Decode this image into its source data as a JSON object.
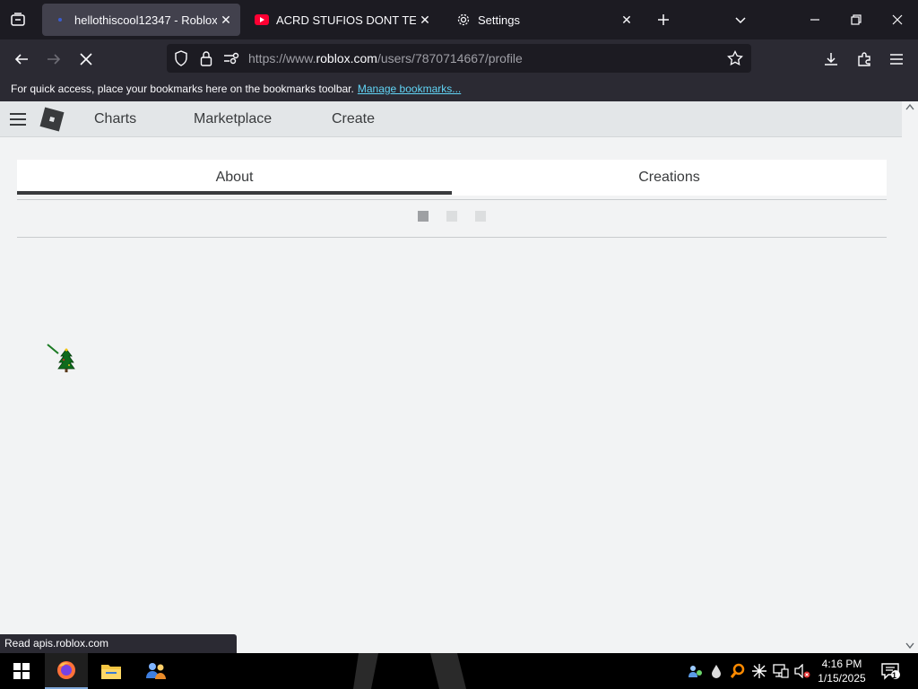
{
  "browser": {
    "tabs": [
      {
        "title": "hellothiscool12347 - Roblox",
        "active": true
      },
      {
        "title": "ACRD STUFIOS DONT TERMINATE",
        "active": false
      },
      {
        "title": "Settings",
        "active": false
      }
    ],
    "url_prefix": "https://www.",
    "url_domain": "roblox.com",
    "url_path": "/users/7870714667/profile",
    "bookmarks_text": "For quick access, place your bookmarks here on the bookmarks toolbar.",
    "bookmarks_link": "Manage bookmarks...",
    "status_text": "Read apis.roblox.com"
  },
  "roblox": {
    "nav": [
      "Charts",
      "Marketplace",
      "Create"
    ],
    "profile_tabs": [
      "About",
      "Creations"
    ],
    "active_tab": "About"
  },
  "taskbar": {
    "time": "4:16 PM",
    "date": "1/15/2025",
    "notification_count": "1"
  },
  "colors": {
    "browser_dark": "#1c1b22",
    "toolbar": "#2b2a33",
    "link": "#61d4f5",
    "roblox_header": "#e3e6e8",
    "page_bg": "#f2f3f4",
    "text": "#393b3d"
  },
  "icons": {
    "tab_list": "tab-list-icon",
    "youtube": "youtube-icon",
    "settings": "gear-icon",
    "back": "back-arrow-icon",
    "forward": "forward-arrow-icon",
    "stop": "stop-x-icon",
    "shield": "tracking-shield-icon",
    "lock": "lock-icon",
    "permissions": "permissions-icon",
    "bookmark": "star-icon",
    "download": "download-icon",
    "extensions": "puzzle-icon",
    "menu": "hamburger-icon",
    "logo": "roblox-logo",
    "start": "windows-logo-icon"
  }
}
